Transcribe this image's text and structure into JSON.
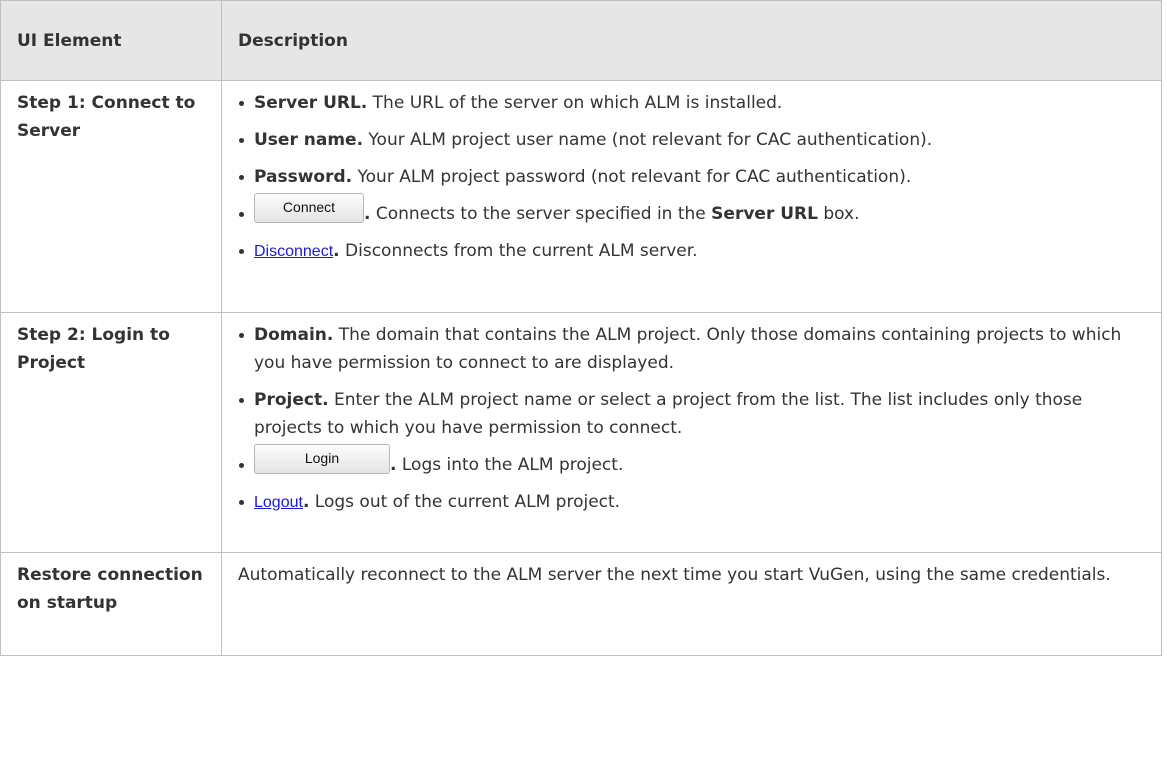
{
  "table": {
    "headers": [
      "UI Element",
      "Description"
    ],
    "rows": [
      {
        "element": "Step 1: Connect to Server",
        "items": [
          {
            "lead": "Server URL.",
            "text": " The URL of the server on which ALM is installed."
          },
          {
            "lead": "User name.",
            "text": " Your ALM project user name (not relevant for CAC authentication)."
          },
          {
            "lead": "Password.",
            "text": " Your ALM project password (not relevant for CAC authentication)."
          },
          {
            "button": "Connect",
            "lead": ".",
            "text_before": " Connects to the server specified in the ",
            "bold": "Server URL",
            "text_after": " box."
          },
          {
            "link": "Disconnect",
            "lead": ".",
            "text": " Disconnects from the current ALM server."
          }
        ]
      },
      {
        "element": "Step 2: Login to Project",
        "items": [
          {
            "lead": "Domain.",
            "text": " The domain that contains the ALM project. Only those domains containing projects to which you have permission to connect to are displayed."
          },
          {
            "lead": "Project.",
            "text": " Enter the ALM project name or select a project from the list. The list includes only those projects to which you have permission to connect."
          },
          {
            "button": "Login",
            "lead": ".",
            "text": " Logs into the ALM project."
          },
          {
            "link": "Logout",
            "lead": ".",
            "text": " Logs out of the current ALM project."
          }
        ]
      },
      {
        "element": "Restore connection on startup",
        "description": "Automatically reconnect to the ALM server the next time you start VuGen, using the same credentials."
      }
    ]
  }
}
